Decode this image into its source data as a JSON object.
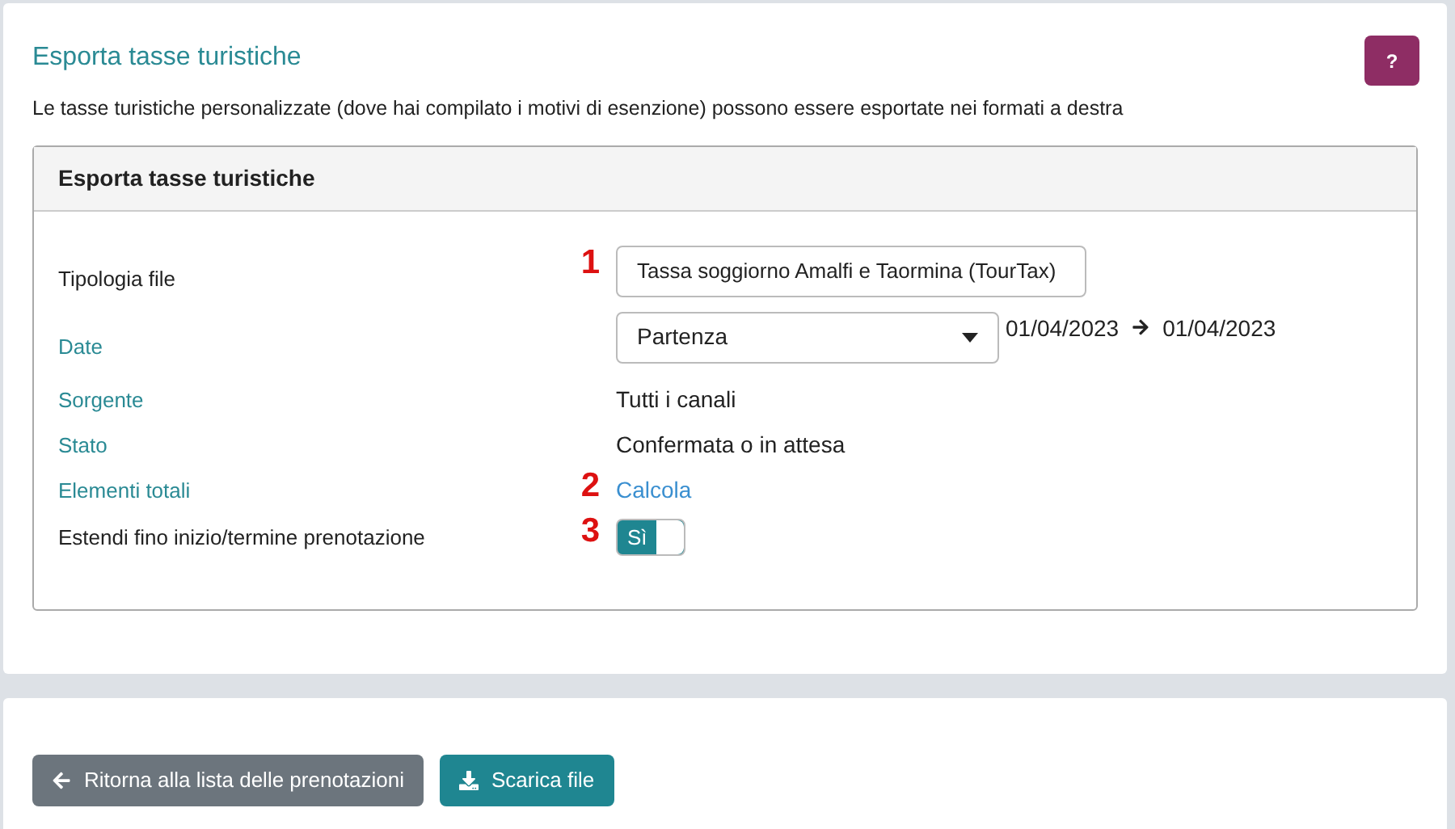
{
  "title": "Esporta tasse turistiche",
  "help_button": "?",
  "description": "Le tasse turistiche personalizzate (dove hai compilato i motivi di esenzione) possono essere esportate nei formati a destra",
  "panel": {
    "title": "Esporta tasse turistiche",
    "rows": [
      {
        "label": "Tipologia file",
        "color": "#222222",
        "annotation": "1",
        "kind": "select",
        "value": "Tassa soggiorno Amalfi e Taormina (TourTax)"
      },
      {
        "label": "Date",
        "color": "#2a8a94",
        "kind": "select_range",
        "value": "Partenza",
        "from": "01/04/2023",
        "to": "01/04/2023"
      },
      {
        "label": "Sorgente",
        "color": "#2a8a94",
        "kind": "text",
        "value": "Tutti i canali"
      },
      {
        "label": "Stato",
        "color": "#2a8a94",
        "kind": "text",
        "value": "Confermata o in attesa"
      },
      {
        "label": "Elementi totali",
        "color": "#2a8a94",
        "annotation": "2",
        "kind": "link",
        "value": "Calcola"
      },
      {
        "label": "Estendi fino inizio/termine prenotazione",
        "color": "#222222",
        "annotation": "3",
        "kind": "toggle",
        "value": "Sì",
        "on": true
      }
    ]
  },
  "buttons": [
    {
      "label": "Ritorna alla lista delle prenotazioni",
      "kind": "back"
    },
    {
      "label": "Scarica file",
      "kind": "download"
    }
  ]
}
